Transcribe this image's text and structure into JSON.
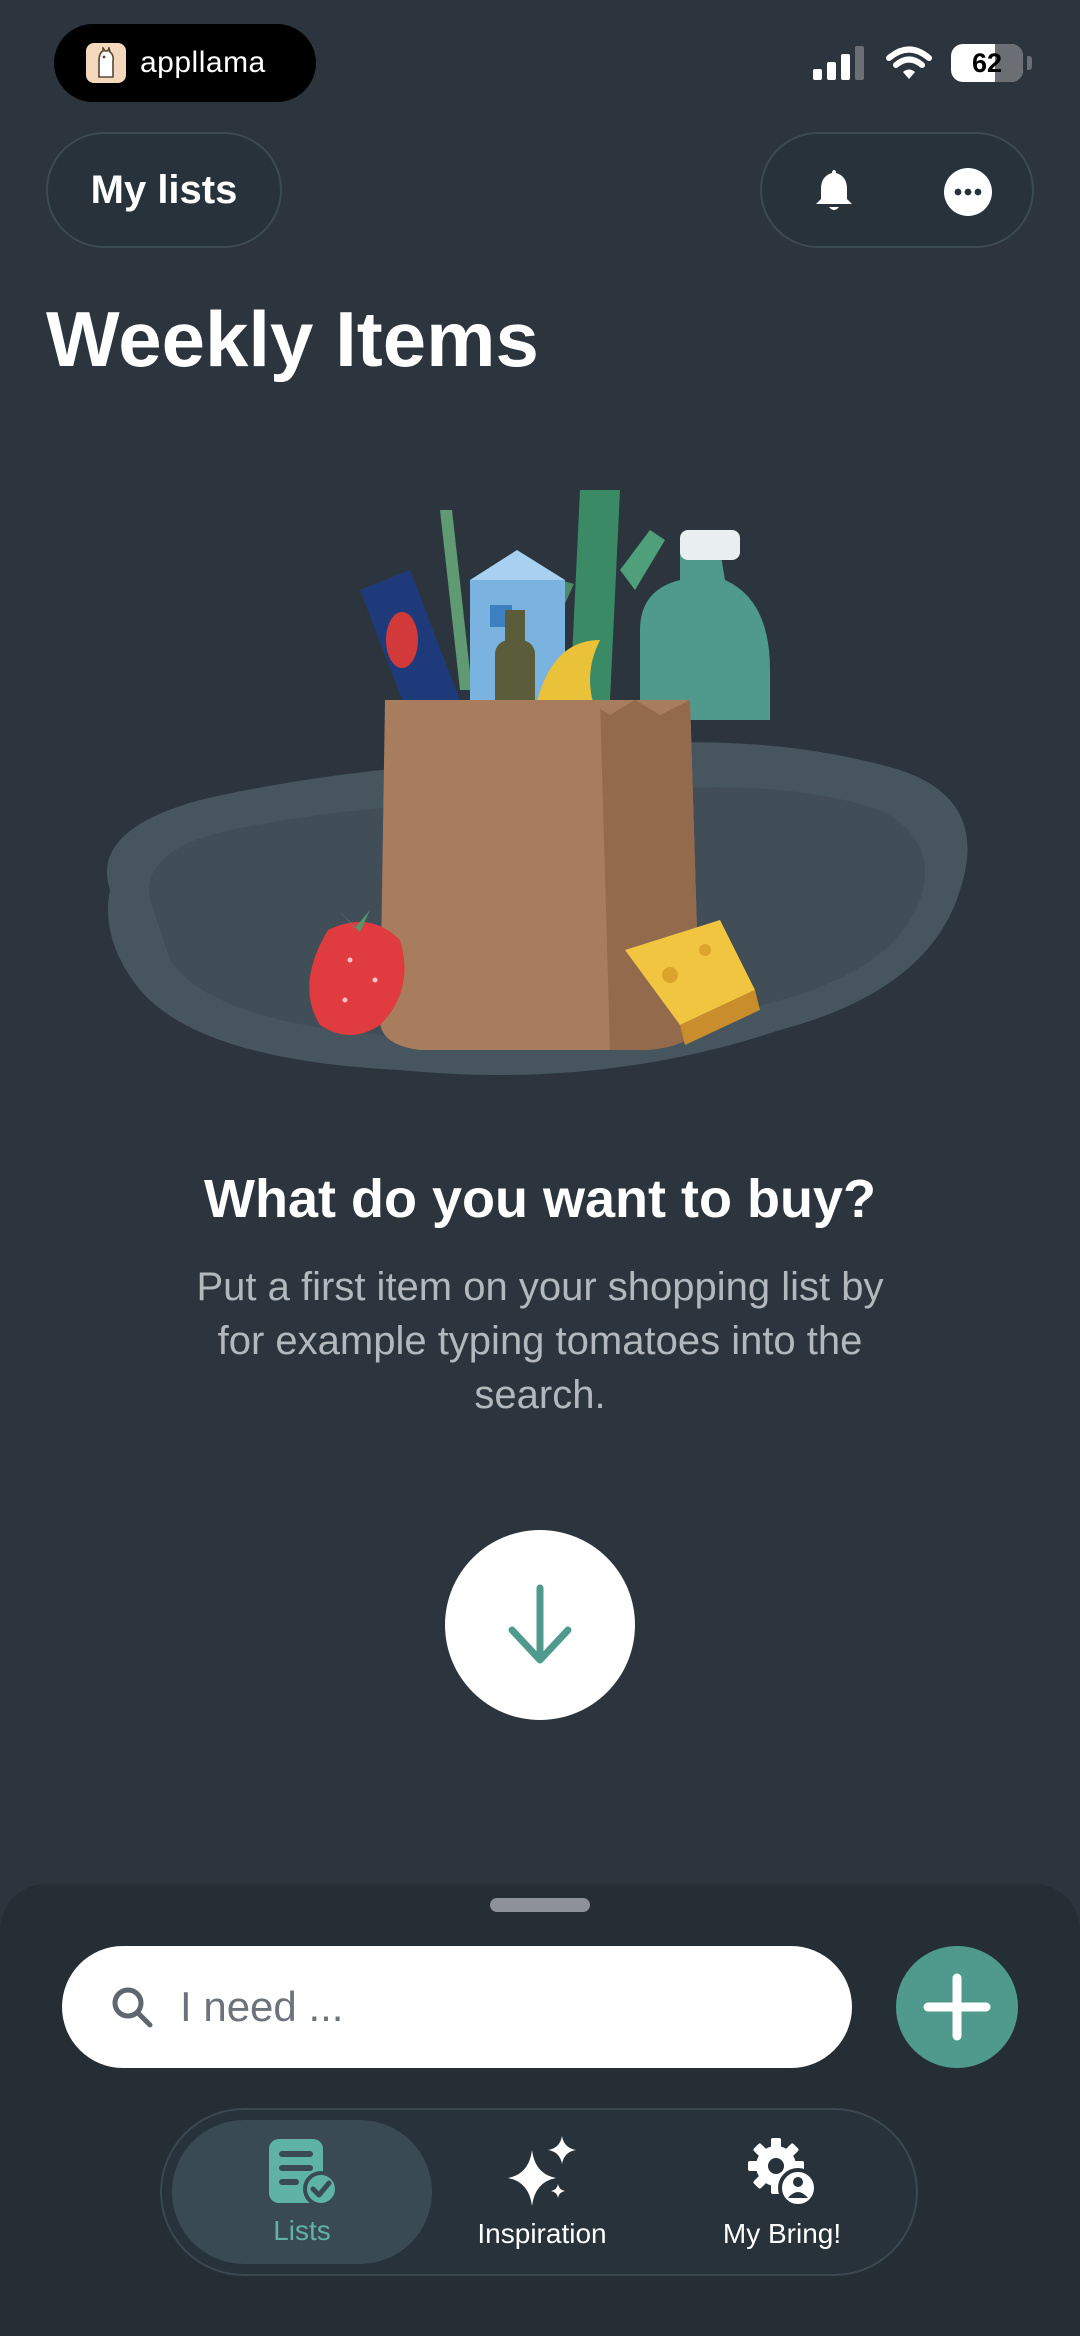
{
  "status_bar": {
    "app_badge": "appllama",
    "battery": "62"
  },
  "header": {
    "lists_button": "My lists",
    "title": "Weekly Items"
  },
  "empty_state": {
    "title": "What do you want to buy?",
    "description": "Put a first item on your shopping list by for example typing tomatoes into the search."
  },
  "search": {
    "placeholder": "I need ..."
  },
  "tabs": [
    {
      "label": "Lists",
      "icon": "list-check-icon",
      "active": true
    },
    {
      "label": "Inspiration",
      "icon": "sparkles-icon",
      "active": false
    },
    {
      "label": "My Bring!",
      "icon": "gear-user-icon",
      "active": false
    }
  ],
  "colors": {
    "background": "#2c353d",
    "accent": "#4f9a8c",
    "active_tab_text": "#5fb3a4",
    "sheet": "#252e35"
  }
}
